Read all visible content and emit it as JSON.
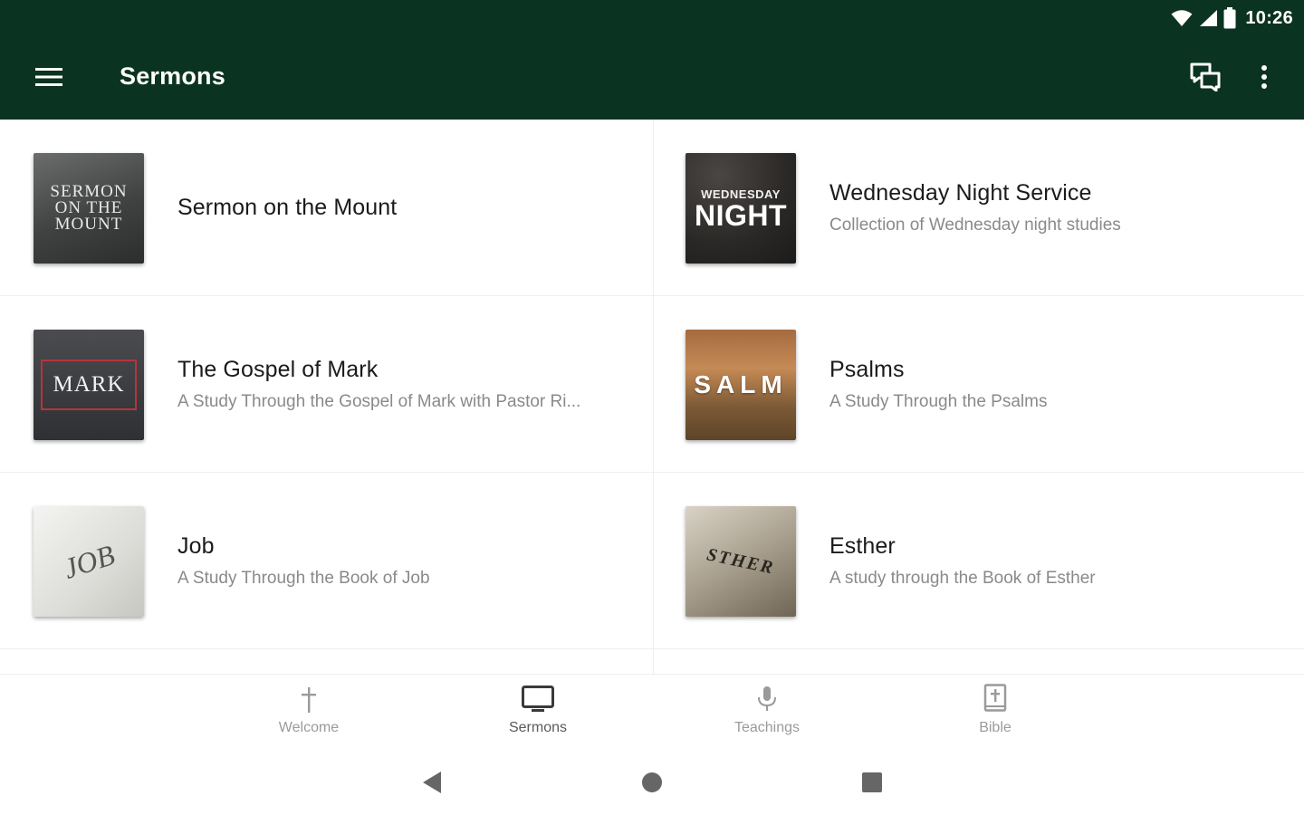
{
  "status_bar": {
    "time": "10:26"
  },
  "app_bar": {
    "title": "Sermons",
    "background": "#0b3321"
  },
  "series": [
    {
      "title": "Sermon on the Mount",
      "subtitle": "",
      "art_text": [
        "SERMON",
        "ON THE",
        "MOUNT"
      ]
    },
    {
      "title": "Wednesday Night Service",
      "subtitle": "Collection of Wednesday night studies",
      "art_text": [
        "WEDNESDAY",
        "NIGHT"
      ]
    },
    {
      "title": "The Gospel of Mark",
      "subtitle": "A Study Through the Gospel of Mark with Pastor Ri...",
      "art_text": [
        "MARK"
      ]
    },
    {
      "title": "Psalms",
      "subtitle": "A Study Through the Psalms",
      "art_text": [
        "SALM"
      ]
    },
    {
      "title": "Job",
      "subtitle": "A Study Through the Book of Job",
      "art_text": [
        "JOB"
      ]
    },
    {
      "title": "Esther",
      "subtitle": "A study through the Book of Esther",
      "art_text": [
        "STHER"
      ]
    }
  ],
  "bottom_nav": [
    {
      "label": "Welcome",
      "icon": "cross-icon"
    },
    {
      "label": "Sermons",
      "icon": "monitor-icon",
      "active": true
    },
    {
      "label": "Teachings",
      "icon": "microphone-icon"
    },
    {
      "label": "Bible",
      "icon": "bible-icon"
    }
  ]
}
